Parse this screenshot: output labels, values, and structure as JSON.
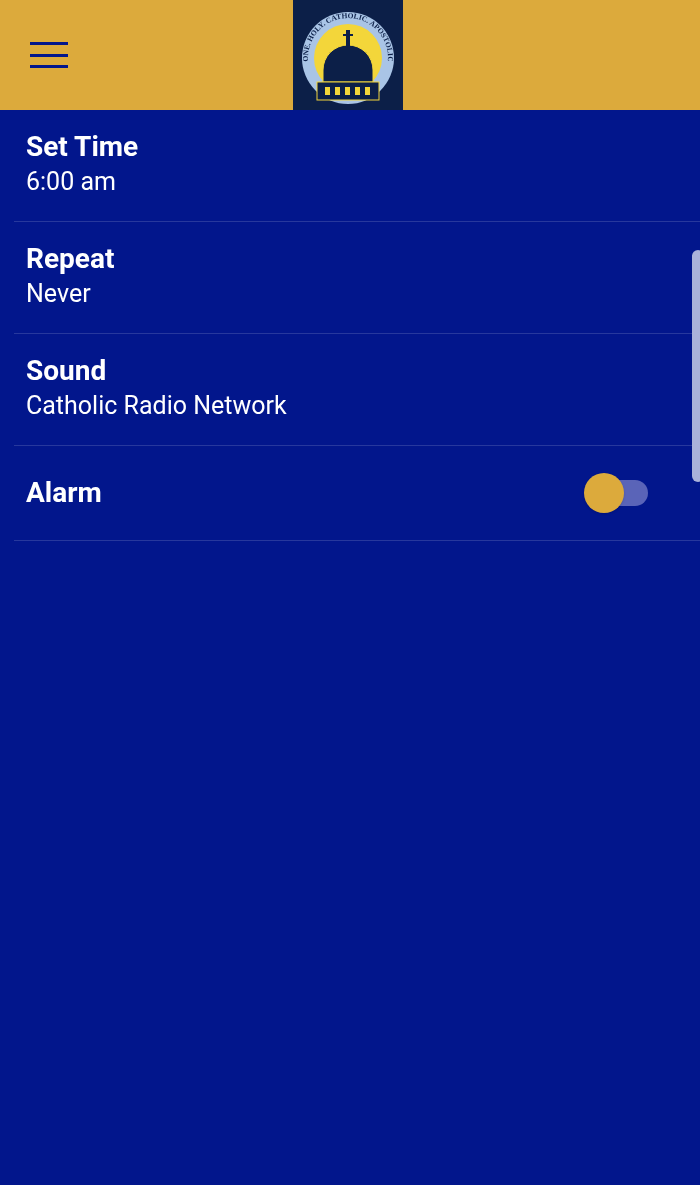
{
  "header": {
    "logo_text": "ONE. HOLY. CATHOLIC. APOSTOLIC"
  },
  "settings": [
    {
      "kind": "value",
      "title": "Set Time",
      "value": "6:00 am"
    },
    {
      "kind": "value",
      "title": "Repeat",
      "value": "Never"
    },
    {
      "kind": "value",
      "title": "Sound",
      "value": "Catholic Radio Network"
    },
    {
      "kind": "toggle",
      "title": "Alarm",
      "on": false
    }
  ]
}
